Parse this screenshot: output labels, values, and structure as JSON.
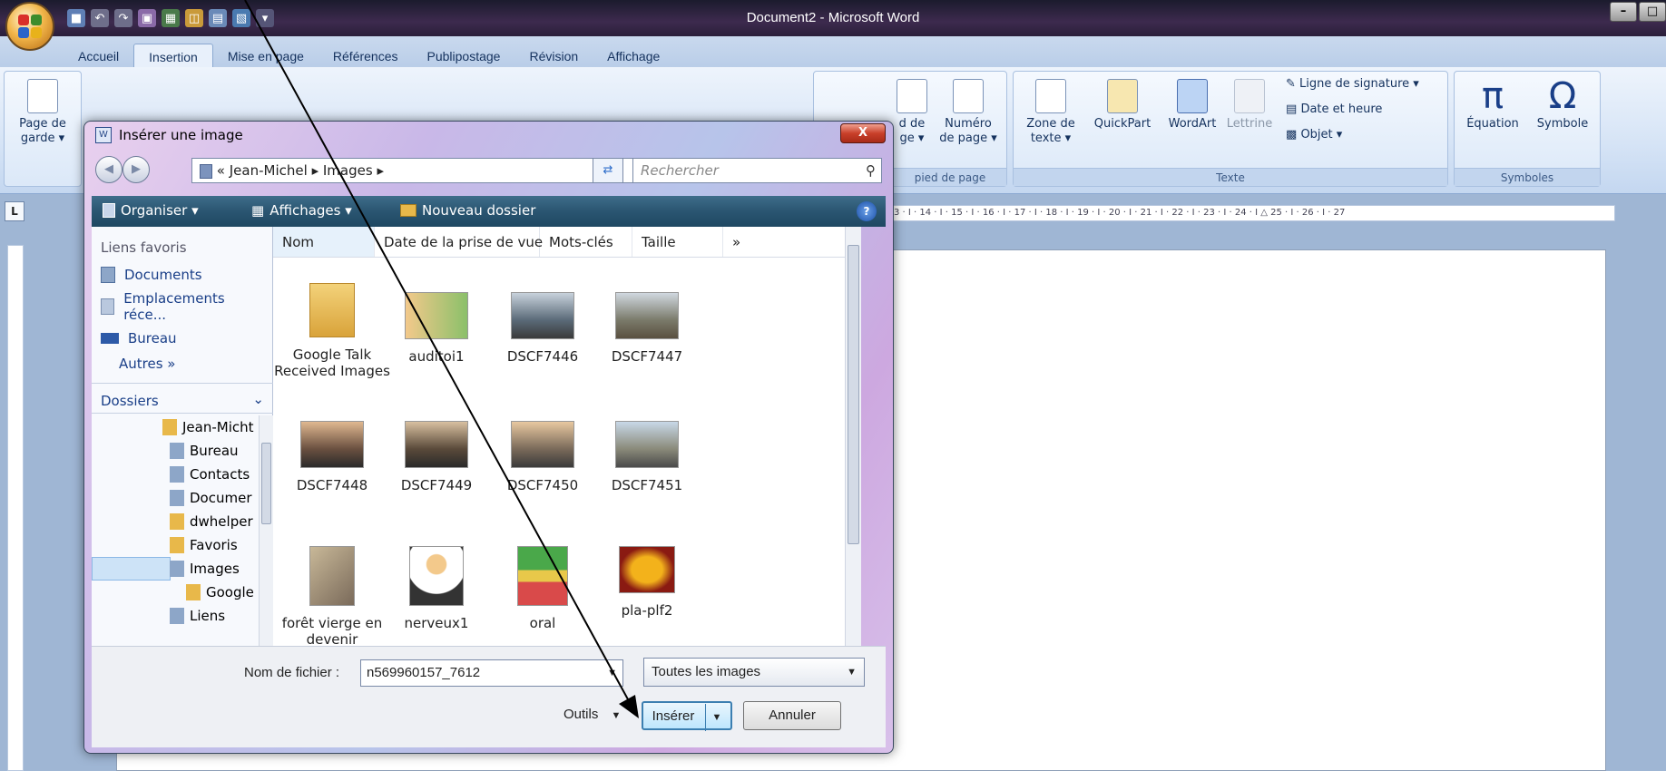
{
  "window": {
    "title": "Document2 - Microsoft Word",
    "controls": [
      "–",
      "□"
    ]
  },
  "tabs": [
    "Accueil",
    "Insertion",
    "Mise en page",
    "Références",
    "Publipostage",
    "Révision",
    "Affichage"
  ],
  "ribbon": {
    "page_de_garde": [
      "Page de",
      "garde ▾"
    ],
    "entete_partial": [
      "d de",
      "ge ▾"
    ],
    "numero": [
      "Numéro",
      "de page ▾"
    ],
    "group_entete": "pied de page",
    "zone_texte": [
      "Zone de",
      "texte ▾"
    ],
    "quickpart": "QuickPart",
    "wordart": "WordArt",
    "lettrine": "Lettrine",
    "ligne_signature": "Ligne de signature ▾",
    "date_heure": "Date et heure",
    "objet": "Objet ▾",
    "group_texte": "Texte",
    "equation": "Équation",
    "symbole": "Symbole",
    "group_symboles": "Symboles"
  },
  "ruler": {
    "corner": "L",
    "text": "3 · I · 14 · I · 15 · I · 16 · I · 17 · I · 18 · I · 19 · I · 20 · I · 21 · I · 22 · I · 23 · I · 24 · I △ 25 · I · 26 · I · 27"
  },
  "dialog": {
    "title": "Insérer une image",
    "close": "X",
    "path_prefix": "«",
    "path_user": "Jean-Michel",
    "path_sep": "▸",
    "path_folder": "Images",
    "search_placeholder": "Rechercher",
    "toolbar": {
      "organiser": "Organiser ▾",
      "affichages": "Affichages ▾",
      "nouveau": "Nouveau dossier",
      "help": "?"
    },
    "favoris_header": "Liens favoris",
    "favoris": [
      "Documents",
      "Emplacements réce...",
      "Bureau"
    ],
    "autres": "Autres »",
    "dossiers": "Dossiers",
    "tree": [
      "Jean-Micht",
      "Bureau",
      "Contacts",
      "Documer",
      "dwhelper",
      "Favoris",
      "Images",
      "Google",
      "Liens"
    ],
    "columns": [
      "Nom",
      "Date de la prise de vue",
      "Mots-clés",
      "Taille",
      "»"
    ],
    "files": [
      {
        "name": "Google Talk Received Images",
        "kind": "folder"
      },
      {
        "name": "auditoi1",
        "kind": "cartoon"
      },
      {
        "name": "DSCF7446",
        "kind": "photo"
      },
      {
        "name": "DSCF7447",
        "kind": "photo"
      },
      {
        "name": "DSCF7448",
        "kind": "photo"
      },
      {
        "name": "DSCF7449",
        "kind": "photo"
      },
      {
        "name": "DSCF7450",
        "kind": "photo"
      },
      {
        "name": "DSCF7451",
        "kind": "photo"
      },
      {
        "name": "forêt vierge en devenir",
        "kind": "photo"
      },
      {
        "name": "nerveux1",
        "kind": "cartoon"
      },
      {
        "name": "oral",
        "kind": "cartoon"
      },
      {
        "name": "pla-plf2",
        "kind": "logo"
      }
    ],
    "filename_label": "Nom de fichier :",
    "filename_value": "n569960157_7612",
    "filter_value": "Toutes les images",
    "outils": "Outils",
    "inserer": "Insérer",
    "annuler": "Annuler"
  },
  "colors": {
    "accent": "#2a5571",
    "folder": "#e8b84a",
    "selection": "#cde3f7"
  }
}
